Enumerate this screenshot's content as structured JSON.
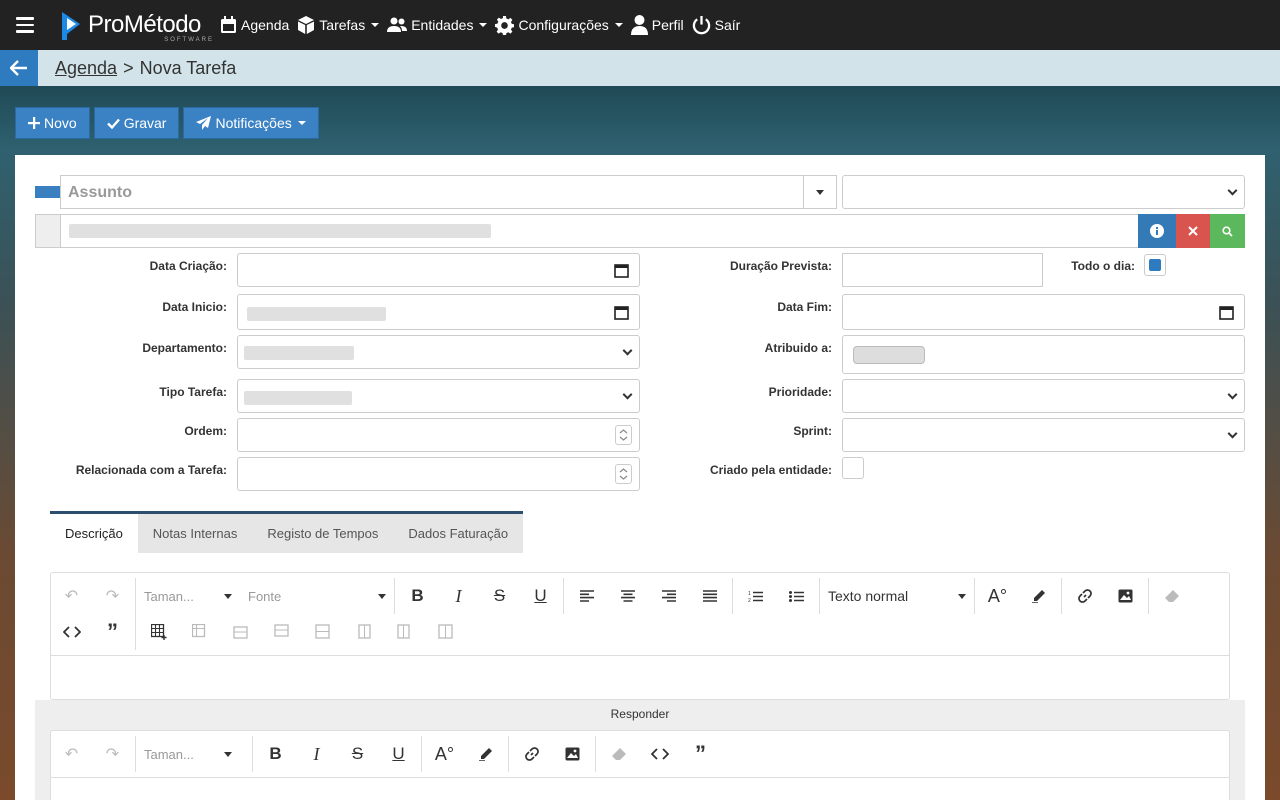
{
  "app": {
    "logo_main": "ProMétodo",
    "logo_sub": "SOFTWARE"
  },
  "nav": {
    "agenda": "Agenda",
    "tarefas": "Tarefas",
    "entidades": "Entidades",
    "configuracoes": "Configurações",
    "perfil": "Perfil",
    "sair": "Saír"
  },
  "breadcrumb": {
    "parent": "Agenda",
    "separator": ">",
    "current": "Nova Tarefa"
  },
  "toolbar": {
    "novo": "Novo",
    "gravar": "Gravar",
    "notificacoes": "Notificações"
  },
  "form": {
    "assunto_placeholder": "Assunto",
    "labels": {
      "data_criacao": "Data Criação:",
      "data_inicio": "Data Inicio:",
      "departamento": "Departamento:",
      "tipo_tarefa": "Tipo Tarefa:",
      "ordem": "Ordem:",
      "relacionada": "Relacionada com a Tarefa:",
      "duracao": "Duração Prevista:",
      "todo_dia": "Todo o dia:",
      "data_fim": "Data Fim:",
      "atribuido": "Atribuido a:",
      "prioridade": "Prioridade:",
      "sprint": "Sprint:",
      "criado_entidade": "Criado pela entidade:"
    },
    "todo_dia_checked": true,
    "criado_entidade_checked": false
  },
  "tabs": [
    "Descrição",
    "Notas Internas",
    "Registo de Tempos",
    "Dados Faturação"
  ],
  "editor": {
    "size_placeholder": "Taman...",
    "font_placeholder": "Fonte",
    "style_value": "Texto normal"
  },
  "reply": {
    "label": "Responder",
    "size_placeholder": "Taman..."
  },
  "colors": {
    "primary": "#3a82c4",
    "danger": "#d9534f",
    "success": "#5cb85c",
    "topbar": "#222222"
  }
}
